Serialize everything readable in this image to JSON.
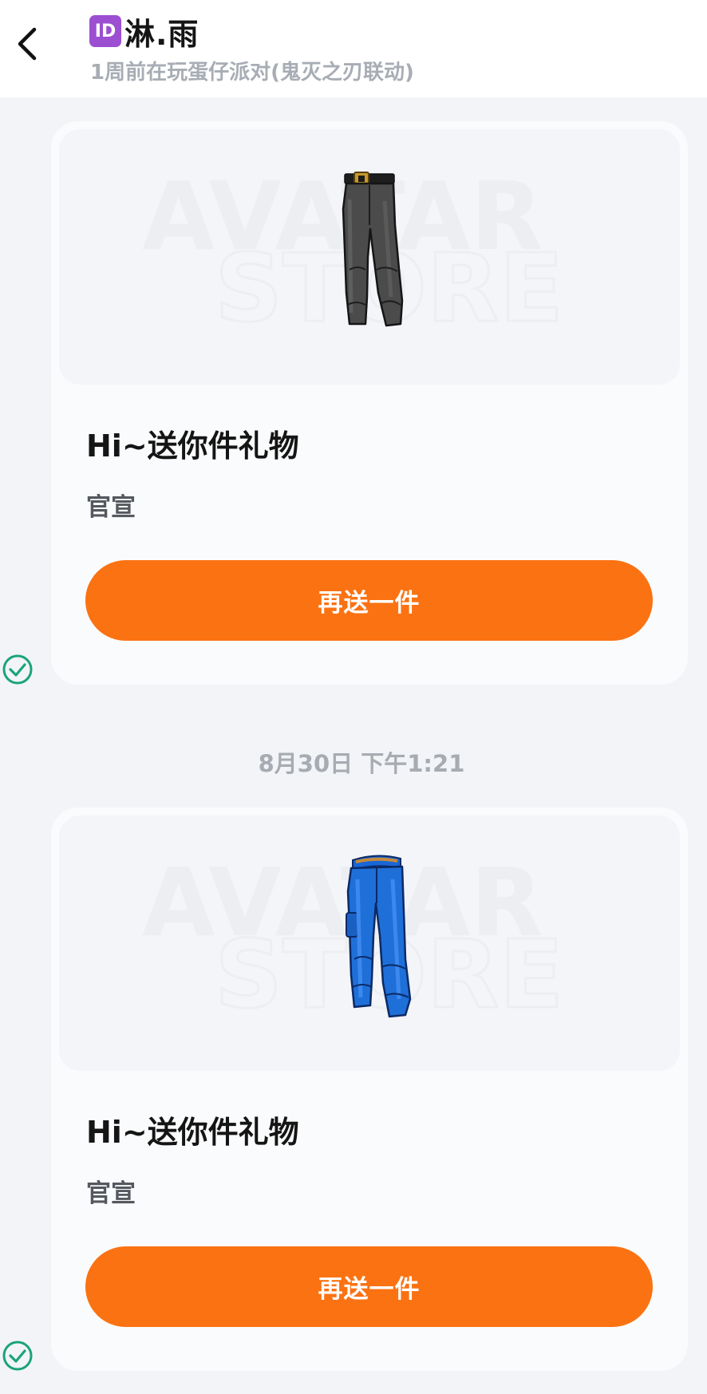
{
  "header": {
    "back_icon": "chevron-left-icon",
    "id_badge": "ID",
    "title": "淋.雨",
    "subtitle": "1周前在玩蛋仔派对(鬼灭之刃联动)"
  },
  "watermark": {
    "line1": "AVATAR",
    "line2": "STORE"
  },
  "messages": [
    {
      "item_icon": "gray-pants-icon",
      "title": "Hi~送你件礼物",
      "subtitle": "官宣",
      "button_label": "再送一件",
      "status_icon": "check-circle-icon"
    },
    {
      "item_icon": "blue-jeans-icon",
      "title": "Hi~送你件礼物",
      "subtitle": "官宣",
      "button_label": "再送一件",
      "status_icon": "check-circle-icon"
    }
  ],
  "timestamp": "8月30日 下午1:21",
  "colors": {
    "accent": "#fb7212",
    "check": "#1aa37a",
    "id_badge": "#9c4fd1"
  }
}
